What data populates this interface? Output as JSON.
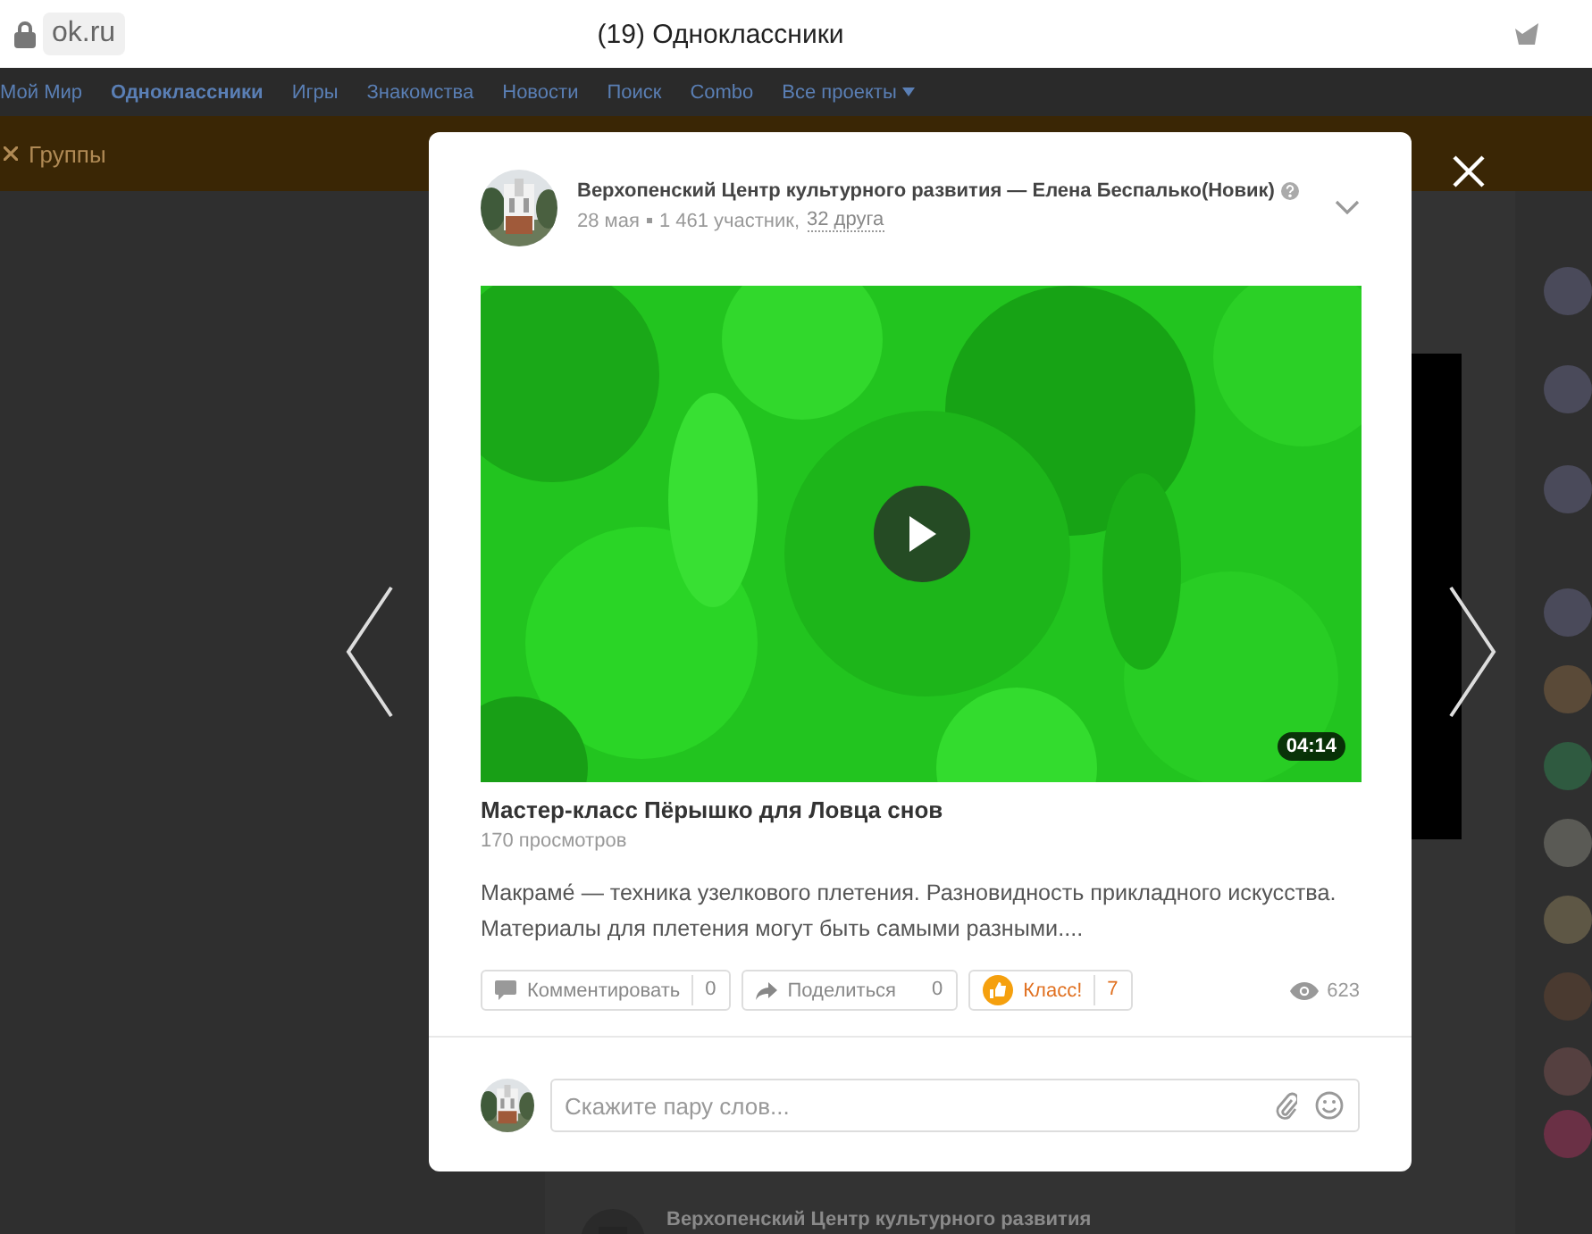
{
  "browser": {
    "address": "ok.ru",
    "title": "(19) Одноклассники"
  },
  "nav": {
    "items": [
      {
        "label": "Мой Мир",
        "selected": false
      },
      {
        "label": "Одноклассники",
        "selected": true
      },
      {
        "label": "Игры",
        "selected": false
      },
      {
        "label": "Знакомства",
        "selected": false
      },
      {
        "label": "Новости",
        "selected": false
      },
      {
        "label": "Поиск",
        "selected": false
      },
      {
        "label": "Combo",
        "selected": false
      },
      {
        "label": "Все проекты",
        "selected": false
      }
    ]
  },
  "toolbar": {
    "section": "Группы"
  },
  "background_post": {
    "title": "Верхопенский Центр культурного развития"
  },
  "post": {
    "author": "Верхопенский Центр культурного развития — Елена Беспалько(Новик)",
    "date": "28 мая",
    "members": "1 461 участник,",
    "friends": "32 друга",
    "video": {
      "duration": "04:14",
      "title": "Мастер-класс Пёрышко для Ловца снов",
      "views": "170 просмотров"
    },
    "text": "Макраме́ — техника узелкового плетения. Разновидность прикладного искусства. Материалы для плетения могут быть самыми разными....",
    "actions": [
      {
        "kind": "comment",
        "label": "Комментировать",
        "count": "0"
      },
      {
        "kind": "share",
        "label": "Поделиться",
        "count": "0"
      },
      {
        "kind": "like",
        "label": "Класс!",
        "count": "7"
      }
    ],
    "view_count": "623",
    "comment": {
      "placeholder": "Скажите пару слов..."
    }
  }
}
